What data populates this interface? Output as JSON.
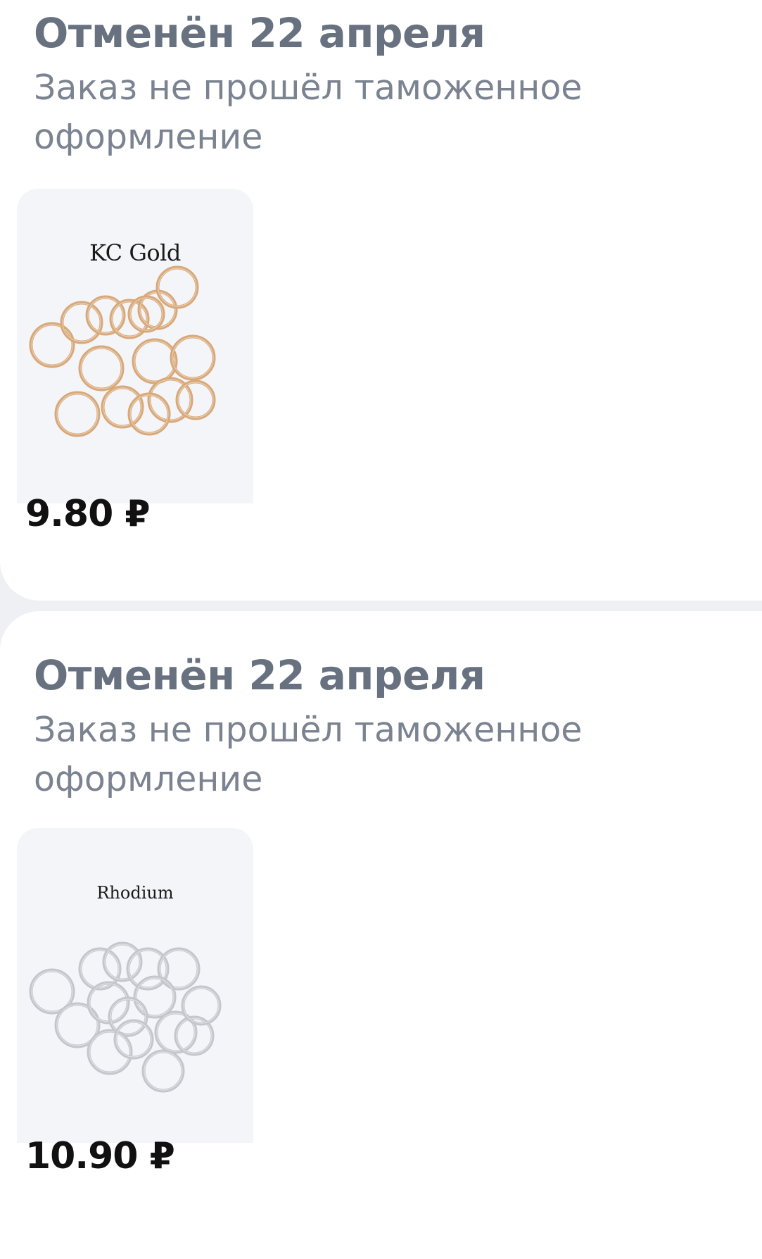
{
  "orders": [
    {
      "status_title": "Отменён 22 апреля",
      "reason": "Заказ не прошёл таможенное оформление",
      "product_label": "KC Gold",
      "price": "9.80 ₽",
      "ring_color": "#d8a878"
    },
    {
      "status_title": "Отменён 22 апреля",
      "reason": "Заказ не прошёл таможенное оформление",
      "product_label": "Rhodium",
      "price": "10.90 ₽",
      "ring_color": "#c4c6cc"
    }
  ]
}
